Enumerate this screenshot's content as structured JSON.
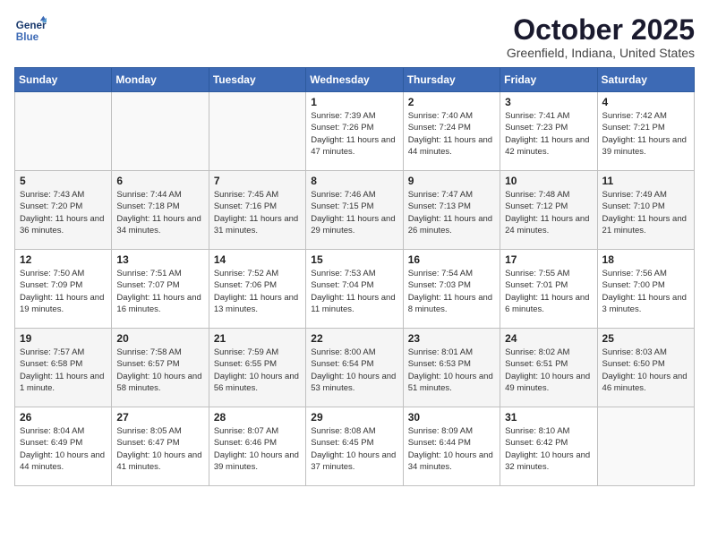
{
  "header": {
    "logo_line1": "General",
    "logo_line2": "Blue",
    "title": "October 2025",
    "subtitle": "Greenfield, Indiana, United States"
  },
  "weekdays": [
    "Sunday",
    "Monday",
    "Tuesday",
    "Wednesday",
    "Thursday",
    "Friday",
    "Saturday"
  ],
  "weeks": [
    [
      {
        "day": "",
        "sunrise": "",
        "sunset": "",
        "daylight": ""
      },
      {
        "day": "",
        "sunrise": "",
        "sunset": "",
        "daylight": ""
      },
      {
        "day": "",
        "sunrise": "",
        "sunset": "",
        "daylight": ""
      },
      {
        "day": "1",
        "sunrise": "Sunrise: 7:39 AM",
        "sunset": "Sunset: 7:26 PM",
        "daylight": "Daylight: 11 hours and 47 minutes."
      },
      {
        "day": "2",
        "sunrise": "Sunrise: 7:40 AM",
        "sunset": "Sunset: 7:24 PM",
        "daylight": "Daylight: 11 hours and 44 minutes."
      },
      {
        "day": "3",
        "sunrise": "Sunrise: 7:41 AM",
        "sunset": "Sunset: 7:23 PM",
        "daylight": "Daylight: 11 hours and 42 minutes."
      },
      {
        "day": "4",
        "sunrise": "Sunrise: 7:42 AM",
        "sunset": "Sunset: 7:21 PM",
        "daylight": "Daylight: 11 hours and 39 minutes."
      }
    ],
    [
      {
        "day": "5",
        "sunrise": "Sunrise: 7:43 AM",
        "sunset": "Sunset: 7:20 PM",
        "daylight": "Daylight: 11 hours and 36 minutes."
      },
      {
        "day": "6",
        "sunrise": "Sunrise: 7:44 AM",
        "sunset": "Sunset: 7:18 PM",
        "daylight": "Daylight: 11 hours and 34 minutes."
      },
      {
        "day": "7",
        "sunrise": "Sunrise: 7:45 AM",
        "sunset": "Sunset: 7:16 PM",
        "daylight": "Daylight: 11 hours and 31 minutes."
      },
      {
        "day": "8",
        "sunrise": "Sunrise: 7:46 AM",
        "sunset": "Sunset: 7:15 PM",
        "daylight": "Daylight: 11 hours and 29 minutes."
      },
      {
        "day": "9",
        "sunrise": "Sunrise: 7:47 AM",
        "sunset": "Sunset: 7:13 PM",
        "daylight": "Daylight: 11 hours and 26 minutes."
      },
      {
        "day": "10",
        "sunrise": "Sunrise: 7:48 AM",
        "sunset": "Sunset: 7:12 PM",
        "daylight": "Daylight: 11 hours and 24 minutes."
      },
      {
        "day": "11",
        "sunrise": "Sunrise: 7:49 AM",
        "sunset": "Sunset: 7:10 PM",
        "daylight": "Daylight: 11 hours and 21 minutes."
      }
    ],
    [
      {
        "day": "12",
        "sunrise": "Sunrise: 7:50 AM",
        "sunset": "Sunset: 7:09 PM",
        "daylight": "Daylight: 11 hours and 19 minutes."
      },
      {
        "day": "13",
        "sunrise": "Sunrise: 7:51 AM",
        "sunset": "Sunset: 7:07 PM",
        "daylight": "Daylight: 11 hours and 16 minutes."
      },
      {
        "day": "14",
        "sunrise": "Sunrise: 7:52 AM",
        "sunset": "Sunset: 7:06 PM",
        "daylight": "Daylight: 11 hours and 13 minutes."
      },
      {
        "day": "15",
        "sunrise": "Sunrise: 7:53 AM",
        "sunset": "Sunset: 7:04 PM",
        "daylight": "Daylight: 11 hours and 11 minutes."
      },
      {
        "day": "16",
        "sunrise": "Sunrise: 7:54 AM",
        "sunset": "Sunset: 7:03 PM",
        "daylight": "Daylight: 11 hours and 8 minutes."
      },
      {
        "day": "17",
        "sunrise": "Sunrise: 7:55 AM",
        "sunset": "Sunset: 7:01 PM",
        "daylight": "Daylight: 11 hours and 6 minutes."
      },
      {
        "day": "18",
        "sunrise": "Sunrise: 7:56 AM",
        "sunset": "Sunset: 7:00 PM",
        "daylight": "Daylight: 11 hours and 3 minutes."
      }
    ],
    [
      {
        "day": "19",
        "sunrise": "Sunrise: 7:57 AM",
        "sunset": "Sunset: 6:58 PM",
        "daylight": "Daylight: 11 hours and 1 minute."
      },
      {
        "day": "20",
        "sunrise": "Sunrise: 7:58 AM",
        "sunset": "Sunset: 6:57 PM",
        "daylight": "Daylight: 10 hours and 58 minutes."
      },
      {
        "day": "21",
        "sunrise": "Sunrise: 7:59 AM",
        "sunset": "Sunset: 6:55 PM",
        "daylight": "Daylight: 10 hours and 56 minutes."
      },
      {
        "day": "22",
        "sunrise": "Sunrise: 8:00 AM",
        "sunset": "Sunset: 6:54 PM",
        "daylight": "Daylight: 10 hours and 53 minutes."
      },
      {
        "day": "23",
        "sunrise": "Sunrise: 8:01 AM",
        "sunset": "Sunset: 6:53 PM",
        "daylight": "Daylight: 10 hours and 51 minutes."
      },
      {
        "day": "24",
        "sunrise": "Sunrise: 8:02 AM",
        "sunset": "Sunset: 6:51 PM",
        "daylight": "Daylight: 10 hours and 49 minutes."
      },
      {
        "day": "25",
        "sunrise": "Sunrise: 8:03 AM",
        "sunset": "Sunset: 6:50 PM",
        "daylight": "Daylight: 10 hours and 46 minutes."
      }
    ],
    [
      {
        "day": "26",
        "sunrise": "Sunrise: 8:04 AM",
        "sunset": "Sunset: 6:49 PM",
        "daylight": "Daylight: 10 hours and 44 minutes."
      },
      {
        "day": "27",
        "sunrise": "Sunrise: 8:05 AM",
        "sunset": "Sunset: 6:47 PM",
        "daylight": "Daylight: 10 hours and 41 minutes."
      },
      {
        "day": "28",
        "sunrise": "Sunrise: 8:07 AM",
        "sunset": "Sunset: 6:46 PM",
        "daylight": "Daylight: 10 hours and 39 minutes."
      },
      {
        "day": "29",
        "sunrise": "Sunrise: 8:08 AM",
        "sunset": "Sunset: 6:45 PM",
        "daylight": "Daylight: 10 hours and 37 minutes."
      },
      {
        "day": "30",
        "sunrise": "Sunrise: 8:09 AM",
        "sunset": "Sunset: 6:44 PM",
        "daylight": "Daylight: 10 hours and 34 minutes."
      },
      {
        "day": "31",
        "sunrise": "Sunrise: 8:10 AM",
        "sunset": "Sunset: 6:42 PM",
        "daylight": "Daylight: 10 hours and 32 minutes."
      },
      {
        "day": "",
        "sunrise": "",
        "sunset": "",
        "daylight": ""
      }
    ]
  ]
}
